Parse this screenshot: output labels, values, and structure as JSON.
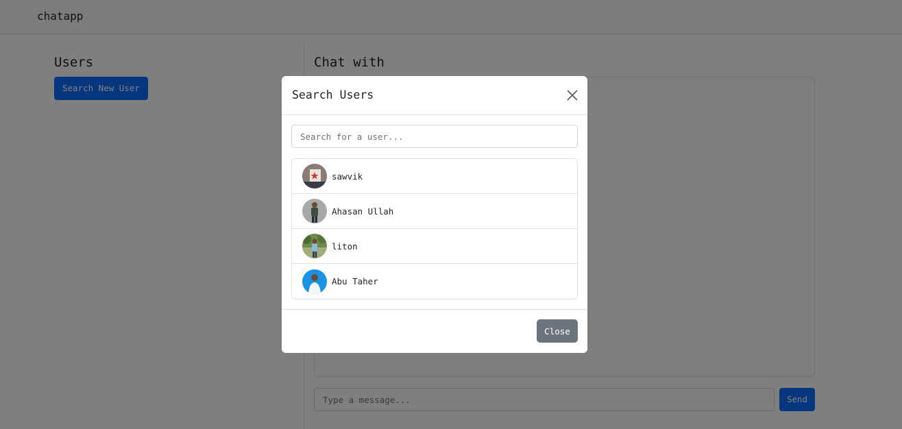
{
  "navbar": {
    "brand": "chatapp"
  },
  "users_panel": {
    "title": "Users",
    "search_button": "Search New User"
  },
  "chat_panel": {
    "title": "Chat with",
    "message_placeholder": "Type a message...",
    "send_button": "Send"
  },
  "modal": {
    "title": "Search Users",
    "search_placeholder": "Search for a user...",
    "users": [
      {
        "name": "sawvik"
      },
      {
        "name": "Ahasan Ullah"
      },
      {
        "name": "liton"
      },
      {
        "name": "Abu Taher"
      }
    ],
    "close_button": "Close"
  },
  "colors": {
    "primary": "#0d6efd",
    "secondary": "#6c757d",
    "backdrop": "rgba(0,0,0,0.5)"
  }
}
